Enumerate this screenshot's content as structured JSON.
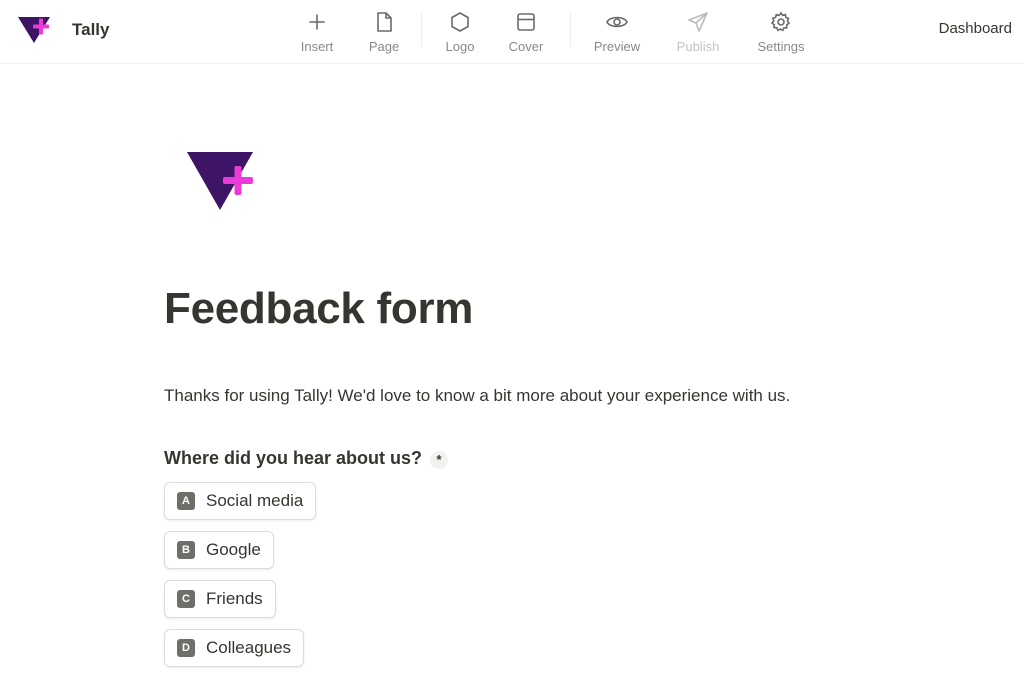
{
  "app": {
    "name": "Tally",
    "brand_purple": "#3d1466",
    "brand_pink": "#ec3ad9"
  },
  "toolbar": {
    "items": [
      {
        "label": "Insert",
        "icon": "plus-icon",
        "disabled": false
      },
      {
        "label": "Page",
        "icon": "page-icon",
        "disabled": false
      },
      {
        "label": "Logo",
        "icon": "hexagon-icon",
        "disabled": false
      },
      {
        "label": "Cover",
        "icon": "cover-icon",
        "disabled": false
      },
      {
        "label": "Preview",
        "icon": "eye-icon",
        "disabled": false
      },
      {
        "label": "Publish",
        "icon": "send-icon",
        "disabled": true
      },
      {
        "label": "Settings",
        "icon": "gear-icon",
        "disabled": false
      }
    ]
  },
  "nav": {
    "dashboard_label": "Dashboard"
  },
  "form": {
    "title": "Feedback form",
    "description": "Thanks for using Tally! We'd love to know a bit more about your experience with us.",
    "question": {
      "text": "Where did you hear about us?",
      "required_mark": "*",
      "options": [
        {
          "key": "A",
          "label": "Social media"
        },
        {
          "key": "B",
          "label": "Google"
        },
        {
          "key": "C",
          "label": "Friends"
        },
        {
          "key": "D",
          "label": "Colleagues"
        }
      ]
    }
  }
}
